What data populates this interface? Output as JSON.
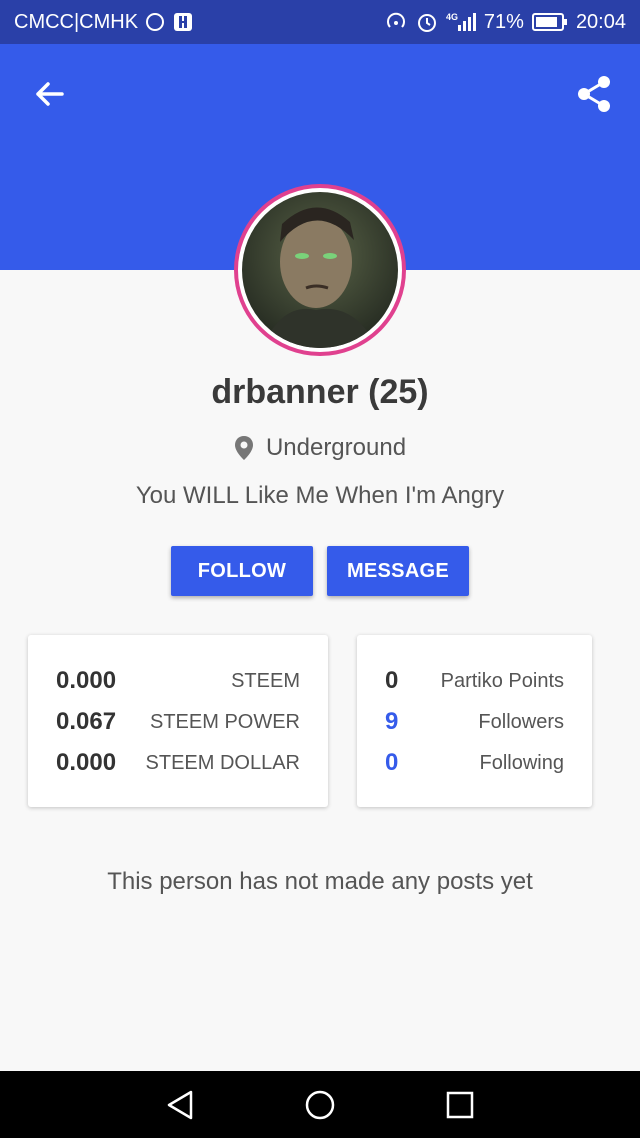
{
  "status_bar": {
    "carrier": "CMCC|CMHK",
    "battery": "71%",
    "time": "20:04",
    "network": "4G"
  },
  "header": {
    "color": "#355bea",
    "back_icon": "arrow-left-icon",
    "share_icon": "share-icon"
  },
  "profile": {
    "username": "drbanner (25)",
    "location": "Underground",
    "bio": "You WILL Like Me When I'm Angry",
    "avatar_ring_color": "#e0418f"
  },
  "actions": {
    "follow_label": "FOLLOW",
    "message_label": "MESSAGE"
  },
  "wallet": [
    {
      "value": "0.000",
      "label": "STEEM"
    },
    {
      "value": "0.067",
      "label": "STEEM POWER"
    },
    {
      "value": "0.000",
      "label": "STEEM DOLLAR"
    }
  ],
  "social": [
    {
      "value": "0",
      "label": "Partiko Points"
    },
    {
      "value": "9",
      "label": "Followers"
    },
    {
      "value": "0",
      "label": "Following"
    }
  ],
  "empty_message": "This person has not made any posts yet"
}
